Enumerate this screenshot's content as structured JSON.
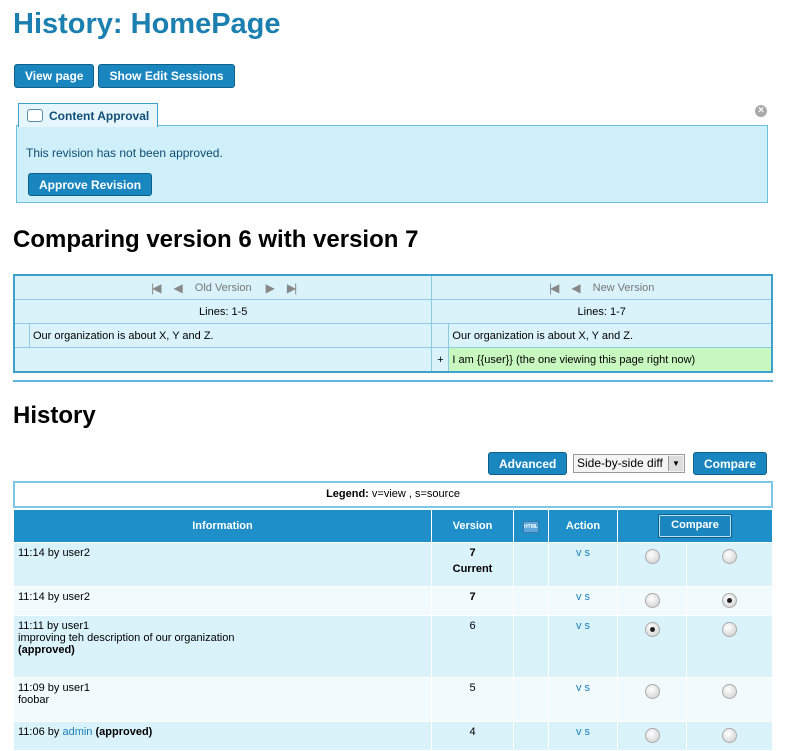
{
  "page_title": "History: HomePage",
  "top_buttons": {
    "view": "View page",
    "sessions": "Show Edit Sessions"
  },
  "approval": {
    "tab_label": "Content Approval",
    "message": "This revision has not been approved.",
    "button": "Approve Revision"
  },
  "compare_title": "Comparing version 6 with version 7",
  "diff": {
    "old_label": "Old Version",
    "new_label": "New Version",
    "old_lines": "Lines: 1-5",
    "new_lines": "Lines: 1-7",
    "old_context": "Our organization is about X, Y and Z.",
    "new_context": "Our organization is about X, Y and Z.",
    "plus": "+",
    "added": "I am {{user}} (the one viewing this page right now)"
  },
  "history_title": "History",
  "controls": {
    "advanced": "Advanced",
    "diff_mode": "Side-by-side diff",
    "compare": "Compare"
  },
  "legend": {
    "label": "Legend:",
    "text": " v=view , s=source"
  },
  "table": {
    "headers": {
      "info": "Information",
      "version": "Version",
      "html_icon": "HTML",
      "action": "Action",
      "compare": "Compare"
    },
    "rows": [
      {
        "time": "11:14 by user2",
        "by_user": "",
        "comment": "",
        "approved": "",
        "version": "7",
        "note": "Current",
        "v": "v",
        "s": "s",
        "left": false,
        "right": false
      },
      {
        "time": "11:14 by user2",
        "by_user": "",
        "comment": "",
        "approved": "",
        "version": "7",
        "note": "",
        "v": "v",
        "s": "s",
        "left": false,
        "right": true
      },
      {
        "time": "11:11 by user1",
        "by_user": "",
        "comment": "improving teh description of our organization",
        "approved": "(approved)",
        "version": "6",
        "note": "",
        "v": "v",
        "s": "s",
        "left": true,
        "right": false
      },
      {
        "time": "11:09 by user1",
        "by_user": "",
        "comment": "foobar",
        "approved": "",
        "version": "5",
        "note": "",
        "v": "v",
        "s": "s",
        "left": false,
        "right": false
      },
      {
        "time": "11:06 by ",
        "by_user": "admin",
        "comment": "",
        "approved": "(approved)",
        "version": "4",
        "note": "",
        "v": "v",
        "s": "s",
        "left": false,
        "right": false
      }
    ]
  }
}
